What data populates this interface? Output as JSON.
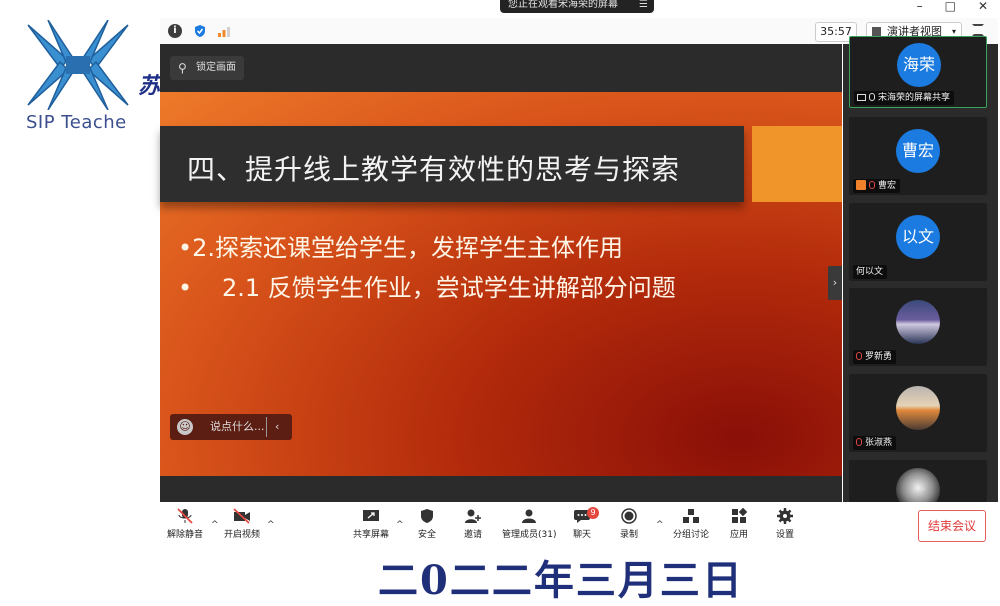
{
  "background": {
    "logo_text": "SIP Teache",
    "logo_char": "苏",
    "date_text": "二0二二年三月三日"
  },
  "window": {
    "share_banner": "您正在观看宋海荣的屏幕",
    "share_banner_menu": "☰",
    "controls": {
      "minimize": "–",
      "maximize": "□",
      "close": "✕"
    }
  },
  "top_toolbar": {
    "info_icon": "i",
    "timer": "35:57",
    "view_mode": "演讲者视图",
    "view_caret": "▾",
    "lock_screen": "锁定画面"
  },
  "slide": {
    "title": "四、提升线上教学有效性的思考与探索",
    "bullet1": "•2.探索还课堂给学生，发挥学生主体作用",
    "bullet2_marker": "•",
    "bullet2": "2.1 反馈学生作业，尝试学生讲解部分问题"
  },
  "chat_input": {
    "placeholder": "说点什么...",
    "arrow": "‹"
  },
  "participants": [
    {
      "avatar": "海荣",
      "name": "宋海荣的屏幕共享",
      "avatar_color": "#1b7be0"
    },
    {
      "avatar": "曹宏",
      "name": "曹宏",
      "avatar_color": "#1b7be0"
    },
    {
      "avatar": "以文",
      "name": "何以文",
      "avatar_color": "#1b7be0"
    },
    {
      "name": "罗新勇"
    },
    {
      "name": "张淑燕"
    }
  ],
  "panel_toggle": "›",
  "scroll_down": "⌄",
  "bottom_toolbar": {
    "unmute": "解除静音",
    "start_video": "开启视频",
    "share_screen": "共享屏幕",
    "security": "安全",
    "invite": "邀请",
    "manage_members": "管理成员(31)",
    "chat": "聊天",
    "chat_badge": "9",
    "record": "录制",
    "breakout": "分组讨论",
    "apps": "应用",
    "settings": "设置",
    "end_meeting": "结束会议",
    "caret": "^"
  },
  "colors": {
    "accent_blue": "#1b7be0",
    "end_red": "#e03a3a",
    "slide_orange": "#f0952a"
  }
}
